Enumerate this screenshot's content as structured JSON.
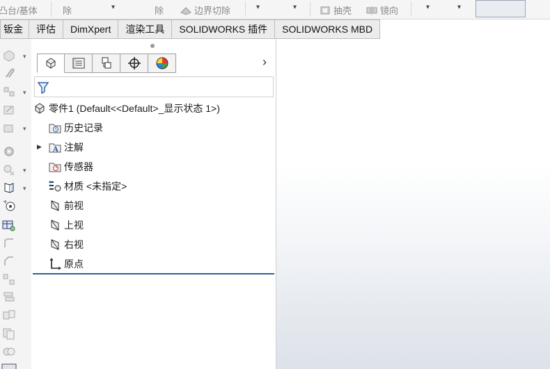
{
  "toolbar": {
    "items": [
      "凸台/基体",
      "除",
      "除",
      "边界切除",
      "抽壳",
      "镜向"
    ]
  },
  "command_tabs": [
    "钣金",
    "评估",
    "DimXpert",
    "渲染工具",
    "SOLIDWORKS 插件",
    "SOLIDWORKS MBD"
  ],
  "feature_tree": {
    "root": "零件1  (Default<<Default>_显示状态 1>)",
    "items": [
      "历史记录",
      "注解",
      "传感器",
      "材质 <未指定>",
      "前视",
      "上视",
      "右视",
      "原点"
    ]
  },
  "colors": {
    "accent_bar": "#2f5d9b"
  },
  "icons": {
    "panel_tabs": [
      "feature-manager-icon",
      "property-manager-icon",
      "configuration-manager-icon",
      "dimxpert-manager-icon",
      "display-manager-icon"
    ],
    "filter": "filter-icon"
  }
}
